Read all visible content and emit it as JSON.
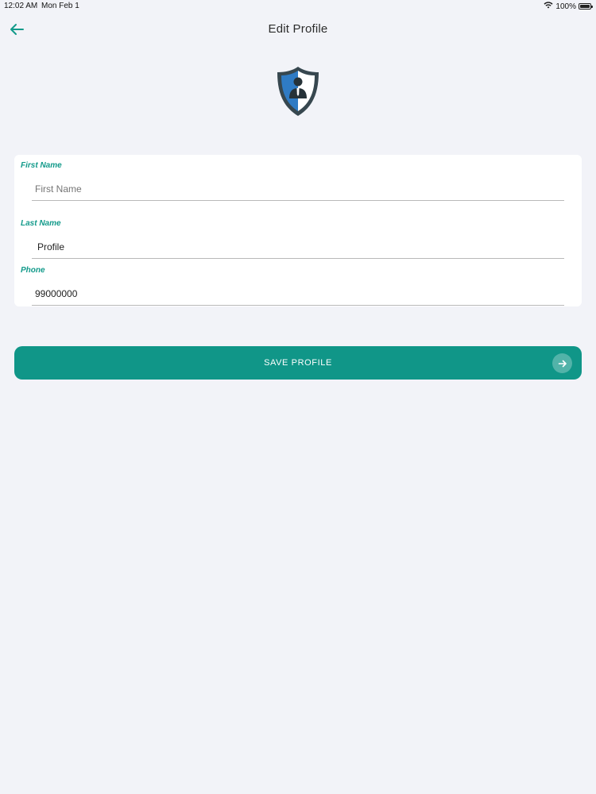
{
  "status_bar": {
    "time": "12:02 AM",
    "date": "Mon Feb 1",
    "battery": "100%",
    "battery_level": 1.0
  },
  "nav": {
    "title": "Edit Profile",
    "back_icon": "arrow-left-icon"
  },
  "avatar": {
    "icon": "shield-user-icon"
  },
  "form": {
    "first_name": {
      "label": "First Name",
      "value": "",
      "placeholder": "First Name"
    },
    "last_name": {
      "label": "Last Name",
      "value": "Profile",
      "placeholder": ""
    },
    "phone": {
      "label": "Phone",
      "value": "99000000",
      "placeholder": ""
    }
  },
  "save_button": {
    "label": "SAVE PROFILE",
    "icon": "arrow-right-icon"
  },
  "colors": {
    "accent": "#109688",
    "label": "#129a8a",
    "background": "#f2f3f8",
    "shield_blue": "#2f7bc4",
    "shield_dark": "#37474f"
  }
}
